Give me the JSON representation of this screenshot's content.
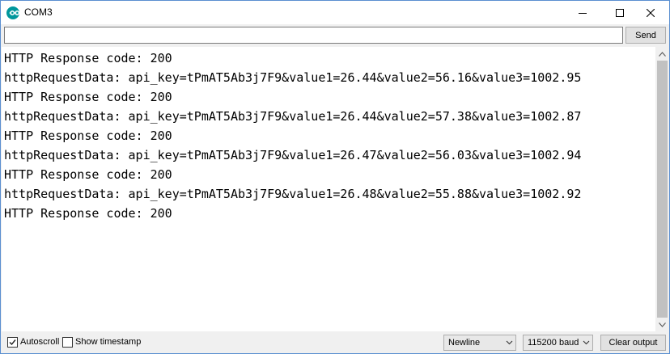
{
  "window": {
    "title": "COM3"
  },
  "input": {
    "value": "",
    "send_label": "Send"
  },
  "output": {
    "lines": [
      "HTTP Response code: 200",
      "httpRequestData: api_key=tPmAT5Ab3j7F9&value1=26.44&value2=56.16&value3=1002.95",
      "HTTP Response code: 200",
      "httpRequestData: api_key=tPmAT5Ab3j7F9&value1=26.44&value2=57.38&value3=1002.87",
      "HTTP Response code: 200",
      "httpRequestData: api_key=tPmAT5Ab3j7F9&value1=26.47&value2=56.03&value3=1002.94",
      "HTTP Response code: 200",
      "httpRequestData: api_key=tPmAT5Ab3j7F9&value1=26.48&value2=55.88&value3=1002.92",
      "HTTP Response code: 200"
    ]
  },
  "bottom": {
    "autoscroll_label": "Autoscroll",
    "autoscroll_checked": true,
    "timestamp_label": "Show timestamp",
    "timestamp_checked": false,
    "line_ending": "Newline",
    "baud_rate": "115200 baud",
    "clear_label": "Clear output"
  },
  "colors": {
    "accent_border": "#5a8fd0",
    "app_icon": "#00979c"
  },
  "icons": {
    "app": "arduino-infinity-icon",
    "minimize": "minimize-icon",
    "maximize": "maximize-icon",
    "close": "close-icon"
  }
}
